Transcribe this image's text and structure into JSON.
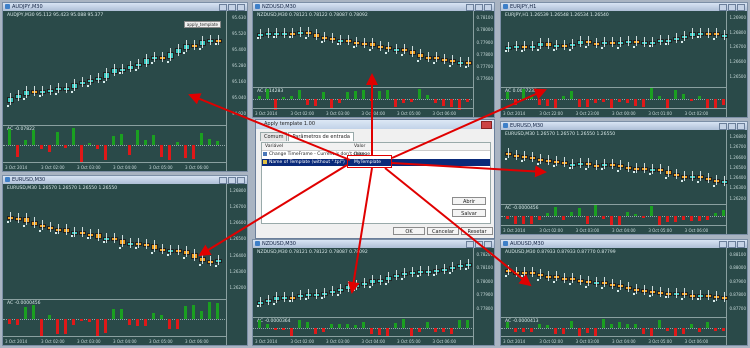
{
  "charts": [
    {
      "title": "AUDJPY,M30",
      "symbol": "AUDJPY,M30 95.112 95.423 95.088 95.377",
      "ac_label": "AC -0.07822",
      "overlay": "apply_template",
      "scale": [
        "95.630",
        "95.520",
        "95.400",
        "95.280",
        "95.160",
        "95.040",
        "94.920"
      ],
      "ac_scale": [
        "0.00800"
      ],
      "times": [
        "3 Oct 2014",
        "3 Oct 02:00",
        "3 Oct 03:00",
        "3 Oct 04:00",
        "3 Oct 05:00",
        "3 Oct 06:00"
      ]
    },
    {
      "title": "NZDUSD,M30",
      "symbol": "NZDUSD,M30 0.78121 0.78122 0.78087 0.78092",
      "ac_label": "AC 0.14283",
      "scale": [
        "0.78100",
        "0.78000",
        "0.77900",
        "0.77800",
        "0.77700",
        "0.77600"
      ],
      "times": [
        "3 Oct 2014",
        "3 Oct 02:00",
        "3 Oct 03:00",
        "3 Oct 04:00",
        "3 Oct 05:00",
        "3 Oct 06:00"
      ]
    },
    {
      "title": "EURJPY,H1",
      "symbol": "EURJPY,H1 1.26539 1.26548 1.26534 1.26540",
      "ac_label": "AC 0.0007235",
      "scale": [
        "1.26900",
        "1.26800",
        "1.26700",
        "1.26600",
        "1.26500"
      ],
      "times": [
        "3 Oct 2014",
        "3 Oct 22:00",
        "3 Oct 23:00",
        "3 Oct 00:00",
        "3 Oct 01:00",
        "3 Oct 02:00"
      ]
    },
    {
      "title": "EURUSD,M30",
      "symbol": "EURUSD,M30 1.26570 1.26570 1.26550 1.26550",
      "ac_label": "AC -0.0000456",
      "scale": [
        "1.26800",
        "1.26700",
        "1.26600",
        "1.26500",
        "1.26400",
        "1.26300",
        "1.26200"
      ],
      "times": [
        "3 Oct 2014",
        "3 Oct 02:00",
        "3 Oct 03:00",
        "3 Oct 04:00",
        "3 Oct 05:00",
        "3 Oct 06:00"
      ]
    },
    {
      "title": "NZDUSD,M30",
      "symbol": "NZDUSD,M30 0.78121 0.78122 0.78087 0.78092",
      "ac_label": "AC -0.0000364",
      "scale": [
        "0.78200",
        "0.78100",
        "0.78000",
        "0.77900",
        "0.77800"
      ],
      "times": [
        "3 Oct 2014",
        "3 Oct 02:00",
        "3 Oct 03:00",
        "3 Oct 04:00",
        "3 Oct 05:00",
        "3 Oct 06:00"
      ]
    },
    {
      "title": "AUDUSD,M30",
      "symbol": "AUDUSD,M30 0.87933 0.87933 0.87770 0.87799",
      "ac_label": "AC -0.0000413",
      "scale": [
        "0.88100",
        "0.88000",
        "0.87900",
        "0.87800",
        "0.87700"
      ],
      "times": [
        "3 Oct 2014",
        "3 Oct 02:00",
        "3 Oct 03:00",
        "3 Oct 04:00",
        "3 Oct 05:00",
        "3 Oct 06:00"
      ]
    }
  ],
  "dialog": {
    "title": "Apply template 1.00",
    "tabs": [
      "Comum",
      "Parâmetros de entrada"
    ],
    "col_variable": "Variável",
    "col_value": "Valor",
    "rows": [
      {
        "name": "Change TimeFrame - Current is don't change",
        "value": "false"
      },
      {
        "name": "Name of Template (without \".tpl\")",
        "value": "MyTemplate"
      }
    ],
    "btn_load": "Abrir",
    "btn_save": "Salvar",
    "btn_ok": "OK",
    "btn_cancel": "Cancelar",
    "btn_reset": "Resetar"
  }
}
